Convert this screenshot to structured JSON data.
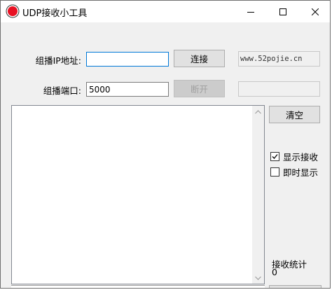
{
  "window": {
    "title": "UDP接收小工具"
  },
  "form": {
    "ip_label": "组播IP地址:",
    "ip_value": "",
    "port_label": "组播端口:",
    "port_value": "5000"
  },
  "buttons": {
    "connect": "连接",
    "disconnect": "断开",
    "clear": "清空"
  },
  "url_box": "www.52pojie.cn",
  "status_box": "",
  "options": {
    "show_receive": {
      "label": "显示接收",
      "checked": true
    },
    "instant_show": {
      "label": "即时显示",
      "checked": false
    }
  },
  "stats": {
    "label": "接收统计",
    "value": "0"
  },
  "colors": {
    "accent": "#0078d7",
    "icon_red": "#e81123"
  }
}
